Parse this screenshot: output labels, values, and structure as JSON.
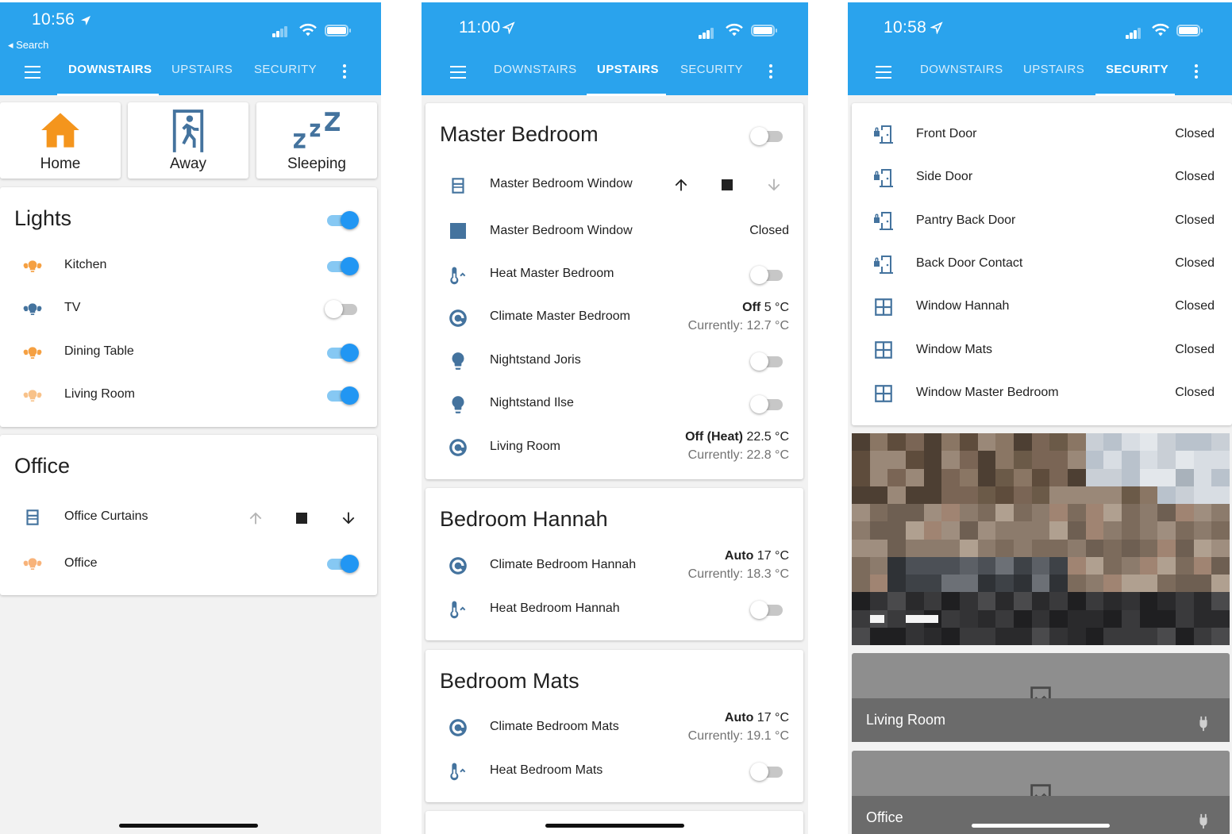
{
  "colors": {
    "appbar": "#2aa3ed",
    "toggle_on": "#2196f3",
    "icon_blue": "#44739e",
    "light_on": "#f5a042"
  },
  "status_bar": {
    "time_1": "10:56",
    "time_2": "11:00",
    "time_3": "10:58",
    "back_label": "◂ Search"
  },
  "tabs": {
    "downstairs": "DOWNSTAIRS",
    "upstairs": "UPSTAIRS",
    "security": "SECURITY"
  },
  "screen_downstairs": {
    "scenes": [
      {
        "label": "Home",
        "icon": "home-icon"
      },
      {
        "label": "Away",
        "icon": "exit-run-icon"
      },
      {
        "label": "Sleeping",
        "icon": "sleep-icon"
      }
    ],
    "lights_card": {
      "title": "Lights",
      "master_on": true,
      "rows": [
        {
          "label": "Kitchen",
          "on": true
        },
        {
          "label": "TV",
          "on": false
        },
        {
          "label": "Dining Table",
          "on": true
        },
        {
          "label": "Living Room",
          "on": true
        }
      ]
    },
    "office_card": {
      "title": "Office",
      "rows": [
        {
          "label": "Office Curtains",
          "icon": "window-shutter-icon"
        },
        {
          "label": "Office",
          "on": true
        }
      ]
    }
  },
  "screen_upstairs": {
    "master_bedroom": {
      "title": "Master Bedroom",
      "master_on": false,
      "rows": [
        {
          "label": "Master Bedroom Window",
          "icon": "window-shutter-icon"
        },
        {
          "label": "Master Bedroom Window",
          "state": "Closed",
          "icon": "square-icon"
        },
        {
          "label": "Heat Master Bedroom",
          "icon": "thermometer-icon",
          "on": false
        },
        {
          "label": "Climate Master Bedroom",
          "icon": "thermostat-icon",
          "mode": "Off",
          "target": "5 °C",
          "current": "Currently: 12.7 °C"
        },
        {
          "label": "Nightstand Joris",
          "icon": "lightbulb-icon",
          "on": false
        },
        {
          "label": "Nightstand Ilse",
          "icon": "lightbulb-icon",
          "on": false
        },
        {
          "label": "Living Room",
          "icon": "thermostat-icon",
          "mode": "Off (Heat)",
          "target": "22.5 °C",
          "current": "Currently: 22.8 °C"
        }
      ]
    },
    "bedroom_hannah": {
      "title": "Bedroom Hannah",
      "rows": [
        {
          "label": "Climate Bedroom Hannah",
          "mode": "Auto",
          "target": "17 °C",
          "current": "Currently: 18.3 °C"
        },
        {
          "label": "Heat Bedroom Hannah",
          "on": false
        }
      ]
    },
    "bedroom_mats": {
      "title": "Bedroom Mats",
      "rows": [
        {
          "label": "Climate Bedroom Mats",
          "mode": "Auto",
          "target": "17 °C",
          "current": "Currently: 19.1 °C"
        },
        {
          "label": "Heat Bedroom Mats",
          "on": false
        }
      ]
    }
  },
  "screen_security": {
    "rows": [
      {
        "label": "Front Door",
        "state": "Closed",
        "icon": "door-closed-lock-icon"
      },
      {
        "label": "Side Door",
        "state": "Closed",
        "icon": "door-closed-lock-icon"
      },
      {
        "label": "Pantry Back Door",
        "state": "Closed",
        "icon": "door-closed-lock-icon"
      },
      {
        "label": "Back Door Contact",
        "state": "Closed",
        "icon": "door-closed-lock-icon"
      },
      {
        "label": "Window Hannah",
        "state": "Closed",
        "icon": "window-closed-icon"
      },
      {
        "label": "Window Mats",
        "state": "Closed",
        "icon": "window-closed-icon"
      },
      {
        "label": "Window Master Bedroom",
        "state": "Closed",
        "icon": "window-closed-icon"
      }
    ],
    "cameras": [
      {
        "label": "Living Room",
        "icon": "image-broken-icon"
      },
      {
        "label": "Office",
        "icon": "image-broken-icon"
      }
    ]
  }
}
